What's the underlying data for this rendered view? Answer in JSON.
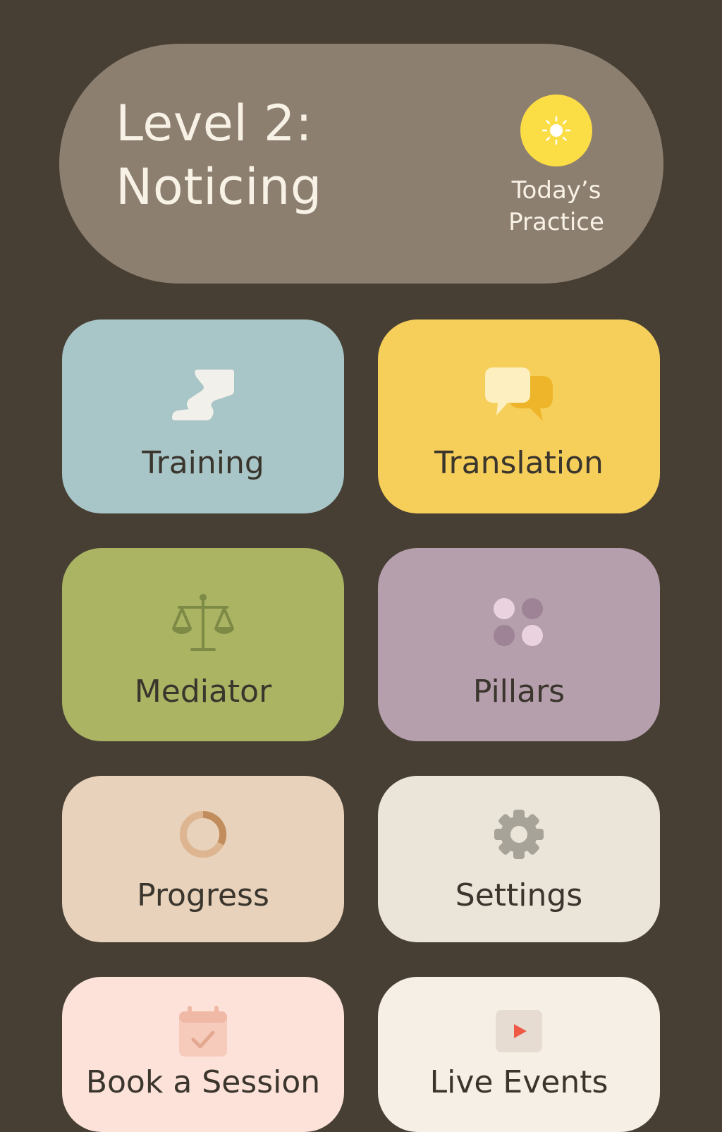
{
  "header": {
    "title_line1": "Level 2:",
    "title_line2": "Noticing",
    "practice": {
      "label_line1": "Today’s",
      "label_line2": "Practice",
      "icon": "sun-icon",
      "color": "#fbdd45"
    }
  },
  "tiles": [
    {
      "label": "Training",
      "icon": "path-steps-icon",
      "color": "#a8c5c7"
    },
    {
      "label": "Translation",
      "icon": "speech-bubbles-icon",
      "color": "#f6cf5b"
    },
    {
      "label": "Mediator",
      "icon": "scales-icon",
      "color": "#aab463"
    },
    {
      "label": "Pillars",
      "icon": "four-dots-icon",
      "color": "#b69fad"
    },
    {
      "label": "Progress",
      "icon": "progress-ring-icon",
      "color": "#e8d2bb"
    },
    {
      "label": "Settings",
      "icon": "gear-icon",
      "color": "#ebe4d9"
    },
    {
      "label": "Book a Session",
      "icon": "calendar-check-icon",
      "color": "#fde2d9"
    },
    {
      "label": "Live Events",
      "icon": "play-video-icon",
      "color": "#f6efe5"
    }
  ]
}
